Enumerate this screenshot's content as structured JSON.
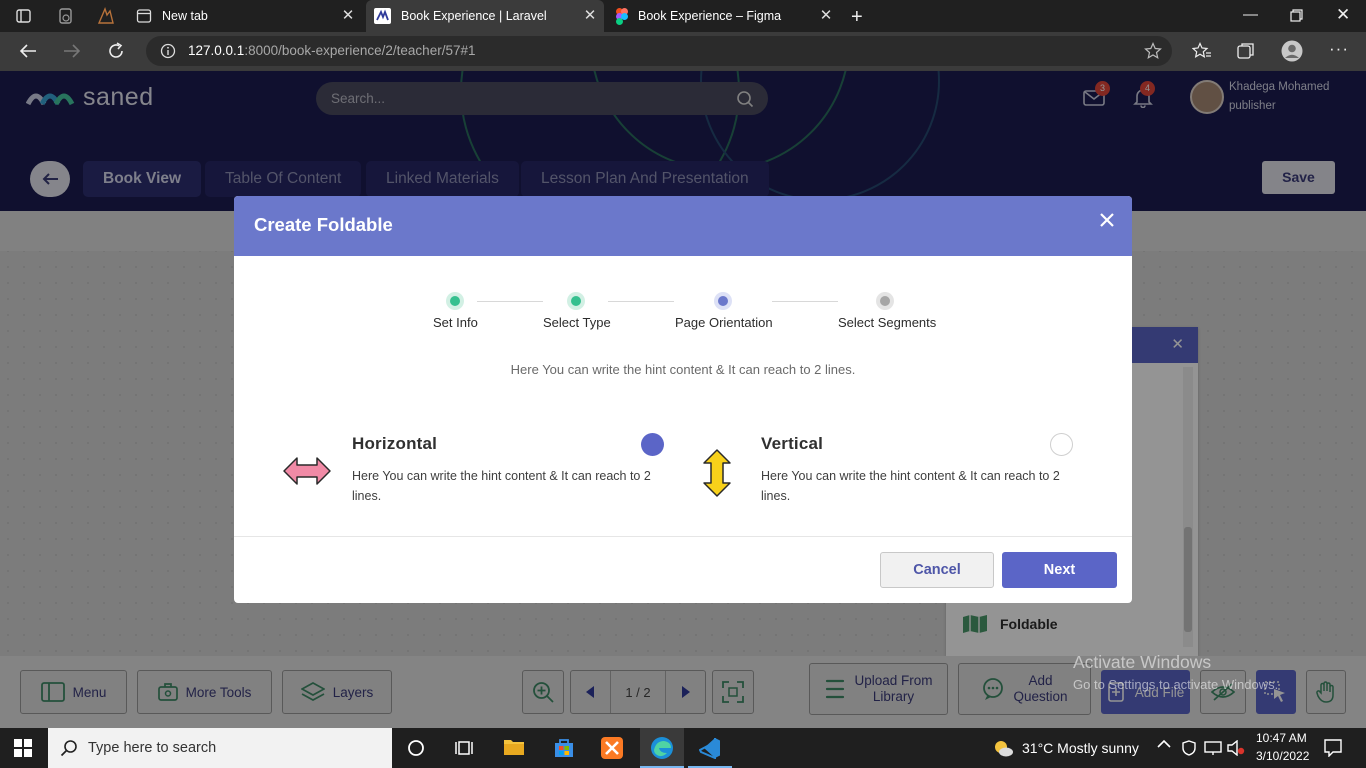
{
  "browser": {
    "tabs": [
      {
        "label": "New tab",
        "icon": "new-tab-icon"
      },
      {
        "label": "Book Experience | Laravel",
        "icon": "laravel-favicon",
        "active": true
      },
      {
        "label": "Book Experience – Figma",
        "icon": "figma-favicon"
      }
    ],
    "url_host": "127.0.0.1",
    "url_rest": ":8000/book-experience/2/teacher/57#1"
  },
  "app": {
    "logo_text": "saned",
    "search_placeholder": "Search...",
    "mail_count": "3",
    "notif_count": "4",
    "user_name": "Khadega Mohamed",
    "user_role": "publisher",
    "nav_tabs": [
      "Book View",
      "Table Of Content",
      "Linked Materials",
      "Lesson Plan And Presentation"
    ],
    "save_label": "Save",
    "side_panel_item": "Foldable"
  },
  "toolbar": {
    "menu_label": "Menu",
    "more_tools_label": "More Tools",
    "layers_label": "Layers",
    "page_indicator": "1 / 2",
    "upload_label_1": "Upload From",
    "upload_label_2": "Library",
    "add_question_1": "Add",
    "add_question_2": "Question",
    "add_file_label": "Add File"
  },
  "modal": {
    "title": "Create Foldable",
    "steps": [
      {
        "label": "Set Info",
        "state": "done"
      },
      {
        "label": "Select Type",
        "state": "done"
      },
      {
        "label": "Page Orientation",
        "state": "current"
      },
      {
        "label": "Select Segments",
        "state": "pending"
      }
    ],
    "hint": "Here You can write the hint content & It can reach to 2 lines.",
    "options": [
      {
        "title": "Horizontal",
        "desc": "Here You can write the hint content & It can reach to 2 lines.",
        "selected": true
      },
      {
        "title": "Vertical",
        "desc": "Here You can write the hint content & It can reach to 2 lines.",
        "selected": false
      }
    ],
    "cancel_label": "Cancel",
    "next_label": "Next"
  },
  "watermark": {
    "line1": "Activate Windows",
    "line2": "Go to Settings to activate Windows."
  },
  "taskbar": {
    "search_placeholder": "Type here to search",
    "weather": "31°C  Mostly sunny",
    "time": "10:47 AM",
    "date": "3/10/2022"
  },
  "colors": {
    "accent": "#6b78cb",
    "primary_button": "#5b65c7",
    "step_done": "#35c08f",
    "header": "#1c1d52"
  }
}
